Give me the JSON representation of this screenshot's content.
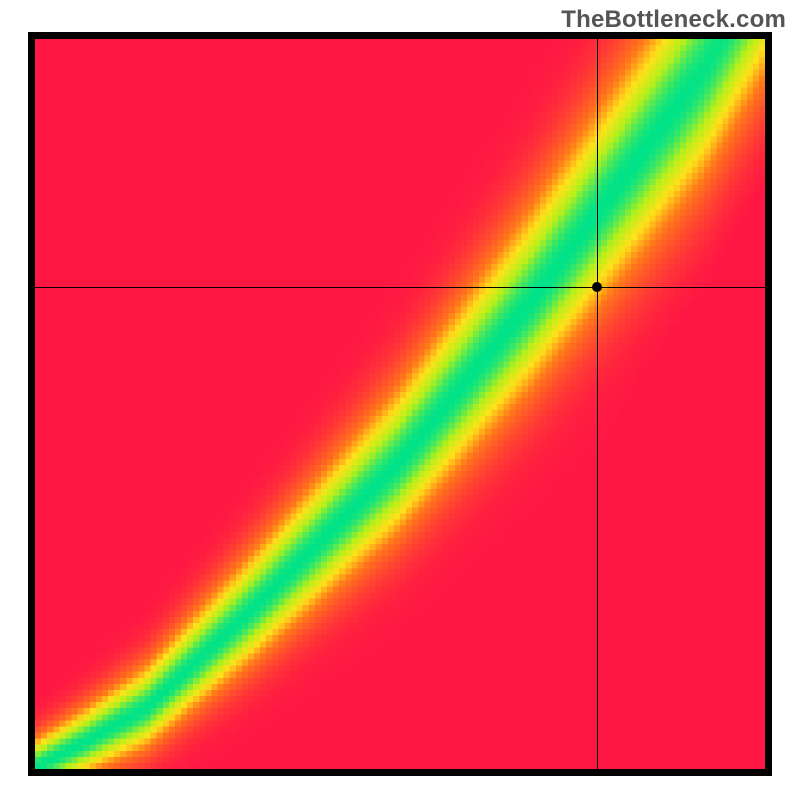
{
  "watermark": "TheBottleneck.com",
  "chart_data": {
    "type": "heatmap",
    "title": "",
    "xlabel": "",
    "ylabel": "",
    "xlim": [
      0,
      100
    ],
    "ylim": [
      0,
      100
    ],
    "grid": false,
    "legend": "none",
    "marker": {
      "x": 77,
      "y": 66
    },
    "crosshair": {
      "x": 77,
      "y": 66
    },
    "color_stops": [
      {
        "t": 0.0,
        "color": "#ff1744"
      },
      {
        "t": 0.4,
        "color": "#ff7a1a"
      },
      {
        "t": 0.62,
        "color": "#ffe21a"
      },
      {
        "t": 0.8,
        "color": "#b7f01a"
      },
      {
        "t": 1.0,
        "color": "#00e389"
      }
    ],
    "fit_model": {
      "description": "Piecewise ideal y(x) curve with tolerance band. fit=1 on curve, 0 far.",
      "knots_x": [
        0,
        6,
        15,
        30,
        50,
        68,
        80,
        92,
        100
      ],
      "knots_y": [
        0,
        3,
        8,
        22,
        42,
        64,
        80,
        96,
        110
      ],
      "sigma_base": 3.0,
      "sigma_gain": 0.1
    },
    "resolution": 120
  }
}
